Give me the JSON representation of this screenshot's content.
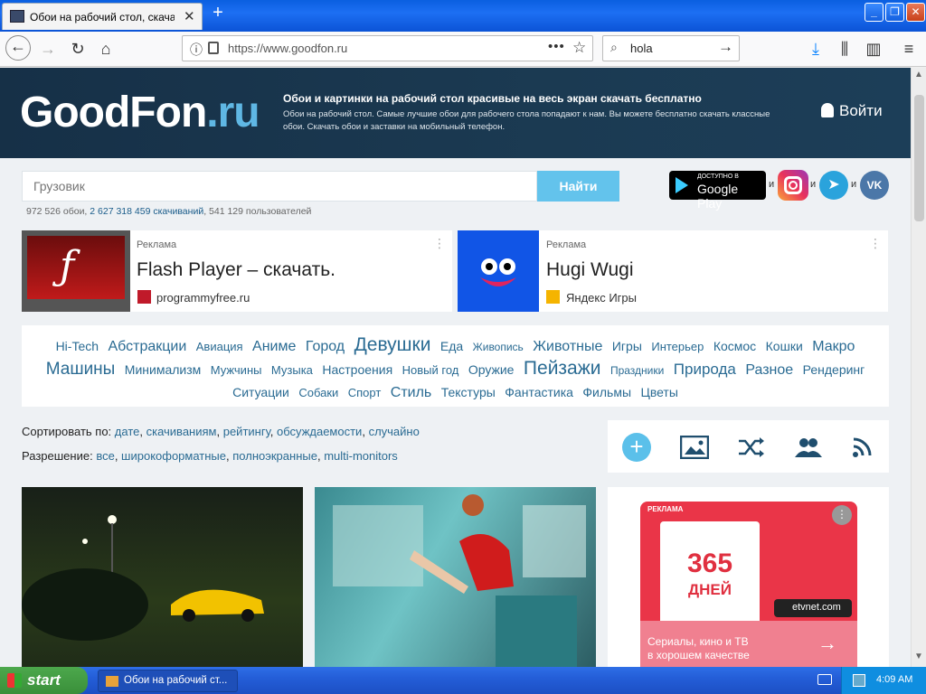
{
  "browser": {
    "tab_title": "Обои на рабочий стол, скачать",
    "url": "https://www.goodfon.ru",
    "search_query": "hola"
  },
  "site": {
    "logo_main": "GoodFon",
    "logo_suffix": ".ru",
    "tagline": "Обои и картинки на рабочий стол красивые на весь экран скачать бесплатно",
    "description": "Обои на рабочий стол. Самые лучшие обои для рабочего стола попадают к нам. Вы можете бесплатно скачать классные обои. Скачать обои и заставки на мобильный телефон.",
    "login": "Войти",
    "search_placeholder": "Грузовик",
    "search_button": "Найти",
    "stats_prefix": "972 526 обои, ",
    "stats_downloads": "2 627 318 459 скачиваний",
    "stats_suffix": ", 541 129 пользователей",
    "gplay_small": "ДОСТУПНО В",
    "gplay_big": "Google Play",
    "and": "и",
    "vk": "VK"
  },
  "ads": [
    {
      "label": "Реклама",
      "title": "Flash Player – скачать.",
      "source": "programmyfree.ru"
    },
    {
      "label": "Реклама",
      "title": "Hugi Wugi",
      "source": "Яндекс Игры"
    }
  ],
  "tags": [
    {
      "t": "Hi-Tech",
      "s": 14
    },
    {
      "t": "Абстракции",
      "s": 16
    },
    {
      "t": "Авиация",
      "s": 13
    },
    {
      "t": "Аниме",
      "s": 16
    },
    {
      "t": "Город",
      "s": 16
    },
    {
      "t": "Девушки",
      "s": 21
    },
    {
      "t": "Еда",
      "s": 14
    },
    {
      "t": "Живопись",
      "s": 12
    },
    {
      "t": "Животные",
      "s": 16
    },
    {
      "t": "Игры",
      "s": 14
    },
    {
      "t": "Интерьер",
      "s": 13
    },
    {
      "t": "Космос",
      "s": 14
    },
    {
      "t": "Кошки",
      "s": 14
    },
    {
      "t": "Макро",
      "s": 16
    },
    {
      "t": "Машины",
      "s": 19
    },
    {
      "t": "Минимализм",
      "s": 14
    },
    {
      "t": "Мужчины",
      "s": 13
    },
    {
      "t": "Музыка",
      "s": 13
    },
    {
      "t": "Настроения",
      "s": 14
    },
    {
      "t": "Новый год",
      "s": 13
    },
    {
      "t": "Оружие",
      "s": 14
    },
    {
      "t": "Пейзажи",
      "s": 21
    },
    {
      "t": "Праздники",
      "s": 12
    },
    {
      "t": "Природа",
      "s": 17
    },
    {
      "t": "Разное",
      "s": 16
    },
    {
      "t": "Рендеринг",
      "s": 14
    },
    {
      "t": "Ситуации",
      "s": 14
    },
    {
      "t": "Собаки",
      "s": 13
    },
    {
      "t": "Спорт",
      "s": 13
    },
    {
      "t": "Стиль",
      "s": 16
    },
    {
      "t": "Текстуры",
      "s": 14
    },
    {
      "t": "Фантастика",
      "s": 14
    },
    {
      "t": "Фильмы",
      "s": 14
    },
    {
      "t": "Цветы",
      "s": 14
    }
  ],
  "sort": {
    "label": "Сортировать по:",
    "options": [
      "дате",
      "скачиваниям",
      "рейтингу",
      "обсуждаемости",
      "случайно"
    ]
  },
  "resolution": {
    "label": "Разрешение:",
    "options": [
      "все",
      "широкоформатные",
      "полноэкранные",
      "multi-monitors"
    ]
  },
  "side_ad": {
    "tag": "РЕКЛАМА",
    "number": "365",
    "unit": "ДНЕЙ",
    "brand": "etvnet.com",
    "text1": "Сериалы, кино и ТВ",
    "text2": "в хорошем качестве"
  },
  "taskbar": {
    "start": "start",
    "task": "Обои на рабочий ст...",
    "clock": "4:09 AM"
  },
  "colors": {
    "accent": "#63c3ec",
    "header": "#163047",
    "link": "#2a6b93"
  }
}
